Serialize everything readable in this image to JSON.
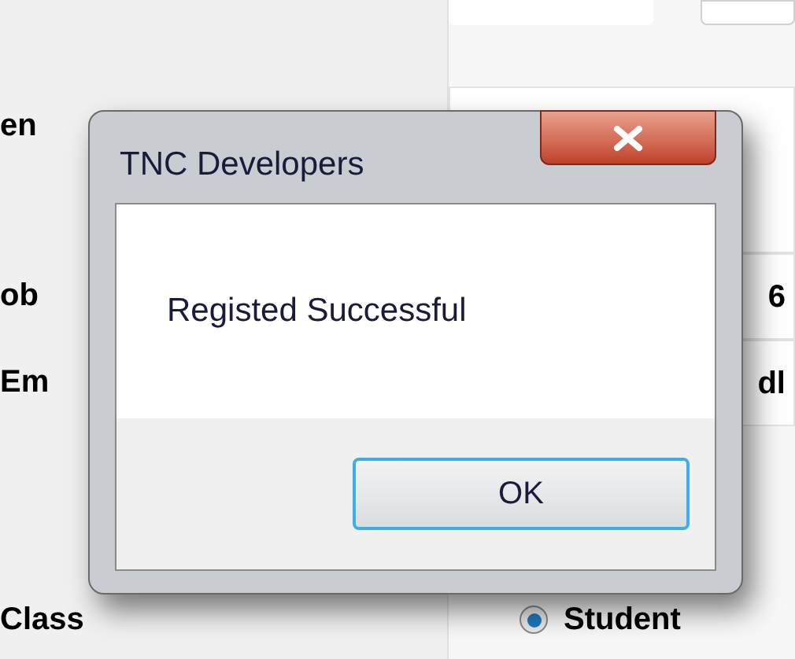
{
  "form": {
    "rows": [
      {
        "label": "en",
        "value": ""
      },
      {
        "label": "ob",
        "value": "6"
      },
      {
        "label": "Em",
        "value": "dl"
      }
    ],
    "class_row": {
      "label": "Class",
      "options": [
        {
          "label": "Student",
          "selected": true
        }
      ]
    }
  },
  "dialog": {
    "title": "TNC Developers",
    "message": "Registed Successful",
    "buttons": [
      "OK"
    ]
  }
}
